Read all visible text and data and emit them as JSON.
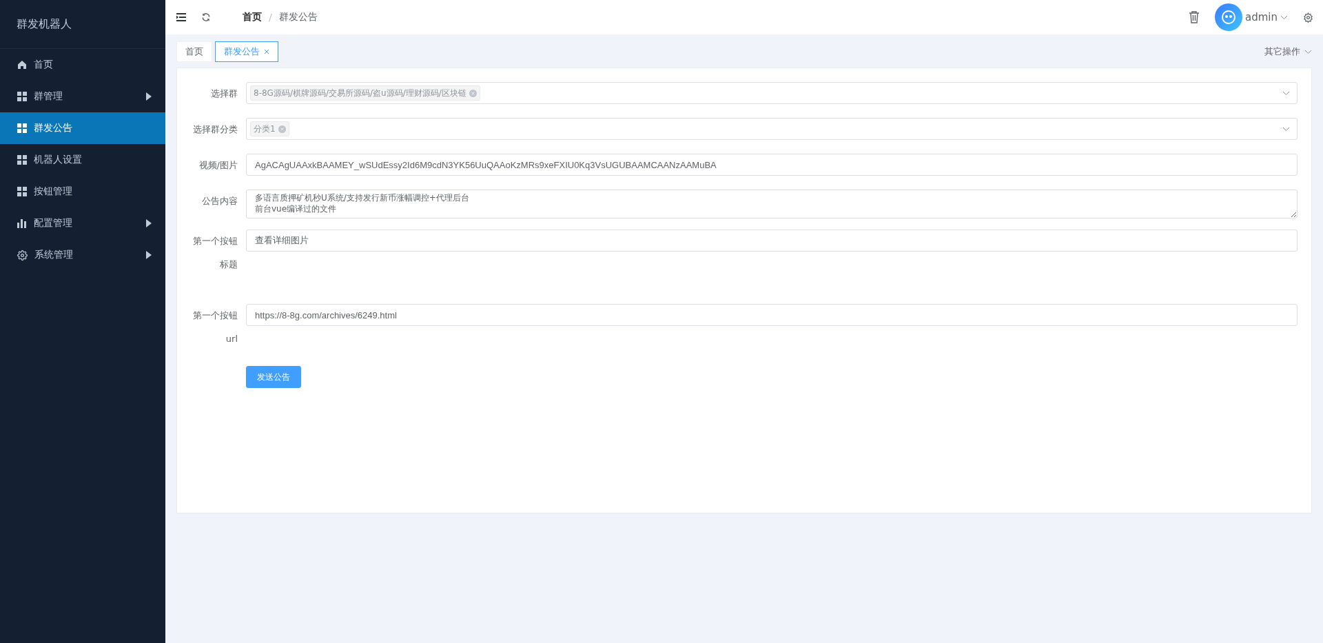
{
  "sidebar": {
    "title": "群发机器人",
    "items": [
      {
        "label": "首页",
        "kind": "home",
        "has_children": false,
        "selected": false
      },
      {
        "label": "群管理",
        "kind": "grid",
        "has_children": true,
        "selected": false
      },
      {
        "label": "群发公告",
        "kind": "grid",
        "has_children": false,
        "selected": true
      },
      {
        "label": "机器人设置",
        "kind": "grid",
        "has_children": false,
        "selected": false
      },
      {
        "label": "按钮管理",
        "kind": "grid",
        "has_children": false,
        "selected": false
      },
      {
        "label": "配置管理",
        "kind": "chart",
        "has_children": true,
        "selected": false
      },
      {
        "label": "系统管理",
        "kind": "gear",
        "has_children": true,
        "selected": false
      }
    ]
  },
  "header": {
    "breadcrumb": [
      "首页",
      "群发公告"
    ],
    "separator": "/",
    "user": "admin"
  },
  "tabs": [
    {
      "label": "首页",
      "selected": false,
      "closable": false
    },
    {
      "label": "群发公告",
      "selected": true,
      "closable": true
    }
  ],
  "other_actions": "其它操作",
  "form": {
    "fields": [
      {
        "kind": "tags",
        "label": "选择群",
        "tags": [
          "8-8G源码/棋牌源码/交易所源码/盗u源码/理财源码/区块链"
        ]
      },
      {
        "kind": "tags",
        "label": "选择群分类",
        "tags": [
          "分类1"
        ]
      },
      {
        "kind": "input",
        "label": "视频/图片",
        "value": "AgACAgUAAxkBAAMEY_wSUdEssy2Id6M9cdN3YK56UuQAAoKzMRs9xeFXIU0Kq3VsUGUBAAMCAANzAAMuBA"
      },
      {
        "kind": "textarea",
        "label": "公告内容",
        "lines": [
          "多语言质押矿机秒U系统/支持发行新币涨幅调控+代理后台",
          "前台vue编译过的文件"
        ]
      },
      {
        "kind": "input",
        "label": "第一个按钮标题",
        "value": "查看详细图片"
      },
      {
        "kind": "input",
        "label": "第一个按钮url",
        "value": "https://8-8g.com/archives/6249.html"
      }
    ],
    "submit": "发送公告"
  }
}
